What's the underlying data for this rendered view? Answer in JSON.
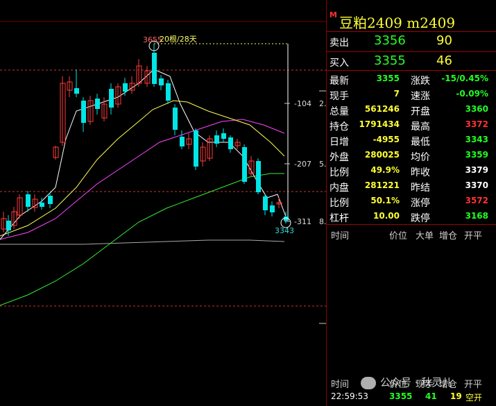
{
  "chart": {
    "high_label": "3655",
    "interval_label": "20根/28天",
    "low_label": "3343",
    "right_ticks": [
      {
        "val": "-104",
        "tail": "2."
      },
      {
        "val": "-207",
        "tail": "5."
      },
      {
        "val": "-311",
        "tail": "8."
      }
    ],
    "colors": {
      "up": "#ff3b3b",
      "down": "#00e5e5",
      "ma5": "#ffffff",
      "ma10": "#ffff55",
      "ma20": "#ff44ff",
      "ma60": "#33ee33",
      "ma120": "#aaaaaa",
      "ref": "#cc3333"
    }
  },
  "panel": {
    "badge": "M",
    "title": "豆粕2409  m2409",
    "sell": {
      "label": "卖出",
      "price": "3356",
      "volume": "90"
    },
    "buy": {
      "label": "买入",
      "price": "3355",
      "volume": "46"
    },
    "rows": [
      {
        "l1": "最新",
        "v1": "3355",
        "c1": "green",
        "l2": "涨跌",
        "v2": "-15/0.45%",
        "c2": "green"
      },
      {
        "l1": "现手",
        "v1": "7",
        "c1": "yellow",
        "l2": "速涨",
        "v2": "-0.09%",
        "c2": "green"
      },
      {
        "l1": "总量",
        "v1": "561246",
        "c1": "yellow",
        "l2": "开盘",
        "v2": "3360",
        "c2": "green"
      },
      {
        "l1": "持仓",
        "v1": "1791434",
        "c1": "yellow",
        "l2": "最高",
        "v2": "3372",
        "c2": "red"
      },
      {
        "l1": "日增",
        "v1": "-4955",
        "c1": "yellow",
        "l2": "最低",
        "v2": "3343",
        "c2": "green"
      },
      {
        "l1": "外盘",
        "v1": "280025",
        "c1": "yellow",
        "l2": "均价",
        "v2": "3359",
        "c2": "green"
      },
      {
        "l1": "比例",
        "v1": "49.9%",
        "c1": "yellow",
        "l2": "昨收",
        "v2": "3379",
        "c2": "white"
      },
      {
        "l1": "内盘",
        "v1": "281221",
        "c1": "yellow",
        "l2": "昨结",
        "v2": "3370",
        "c2": "white"
      },
      {
        "l1": "比例",
        "v1": "50.1%",
        "c1": "yellow",
        "l2": "涨停",
        "v2": "3572",
        "c2": "red"
      },
      {
        "l1": "杠杆",
        "v1": "10.00",
        "c1": "yellow",
        "l2": "跌停",
        "v2": "3168",
        "c2": "green"
      }
    ],
    "tick_header": {
      "time": "时间",
      "price": "价位",
      "big": "大单",
      "oi": "增仓",
      "open": "开平"
    },
    "tick_header2": {
      "time": "时间",
      "price": "价位",
      "hand": "现手",
      "oi": "增仓",
      "open": "开平"
    },
    "last_tick": {
      "time": "22:59:53",
      "price": "3355",
      "hand": "41",
      "oi": "19",
      "open": "空开"
    },
    "watermark": "公众号 · 秋灵儿"
  }
}
